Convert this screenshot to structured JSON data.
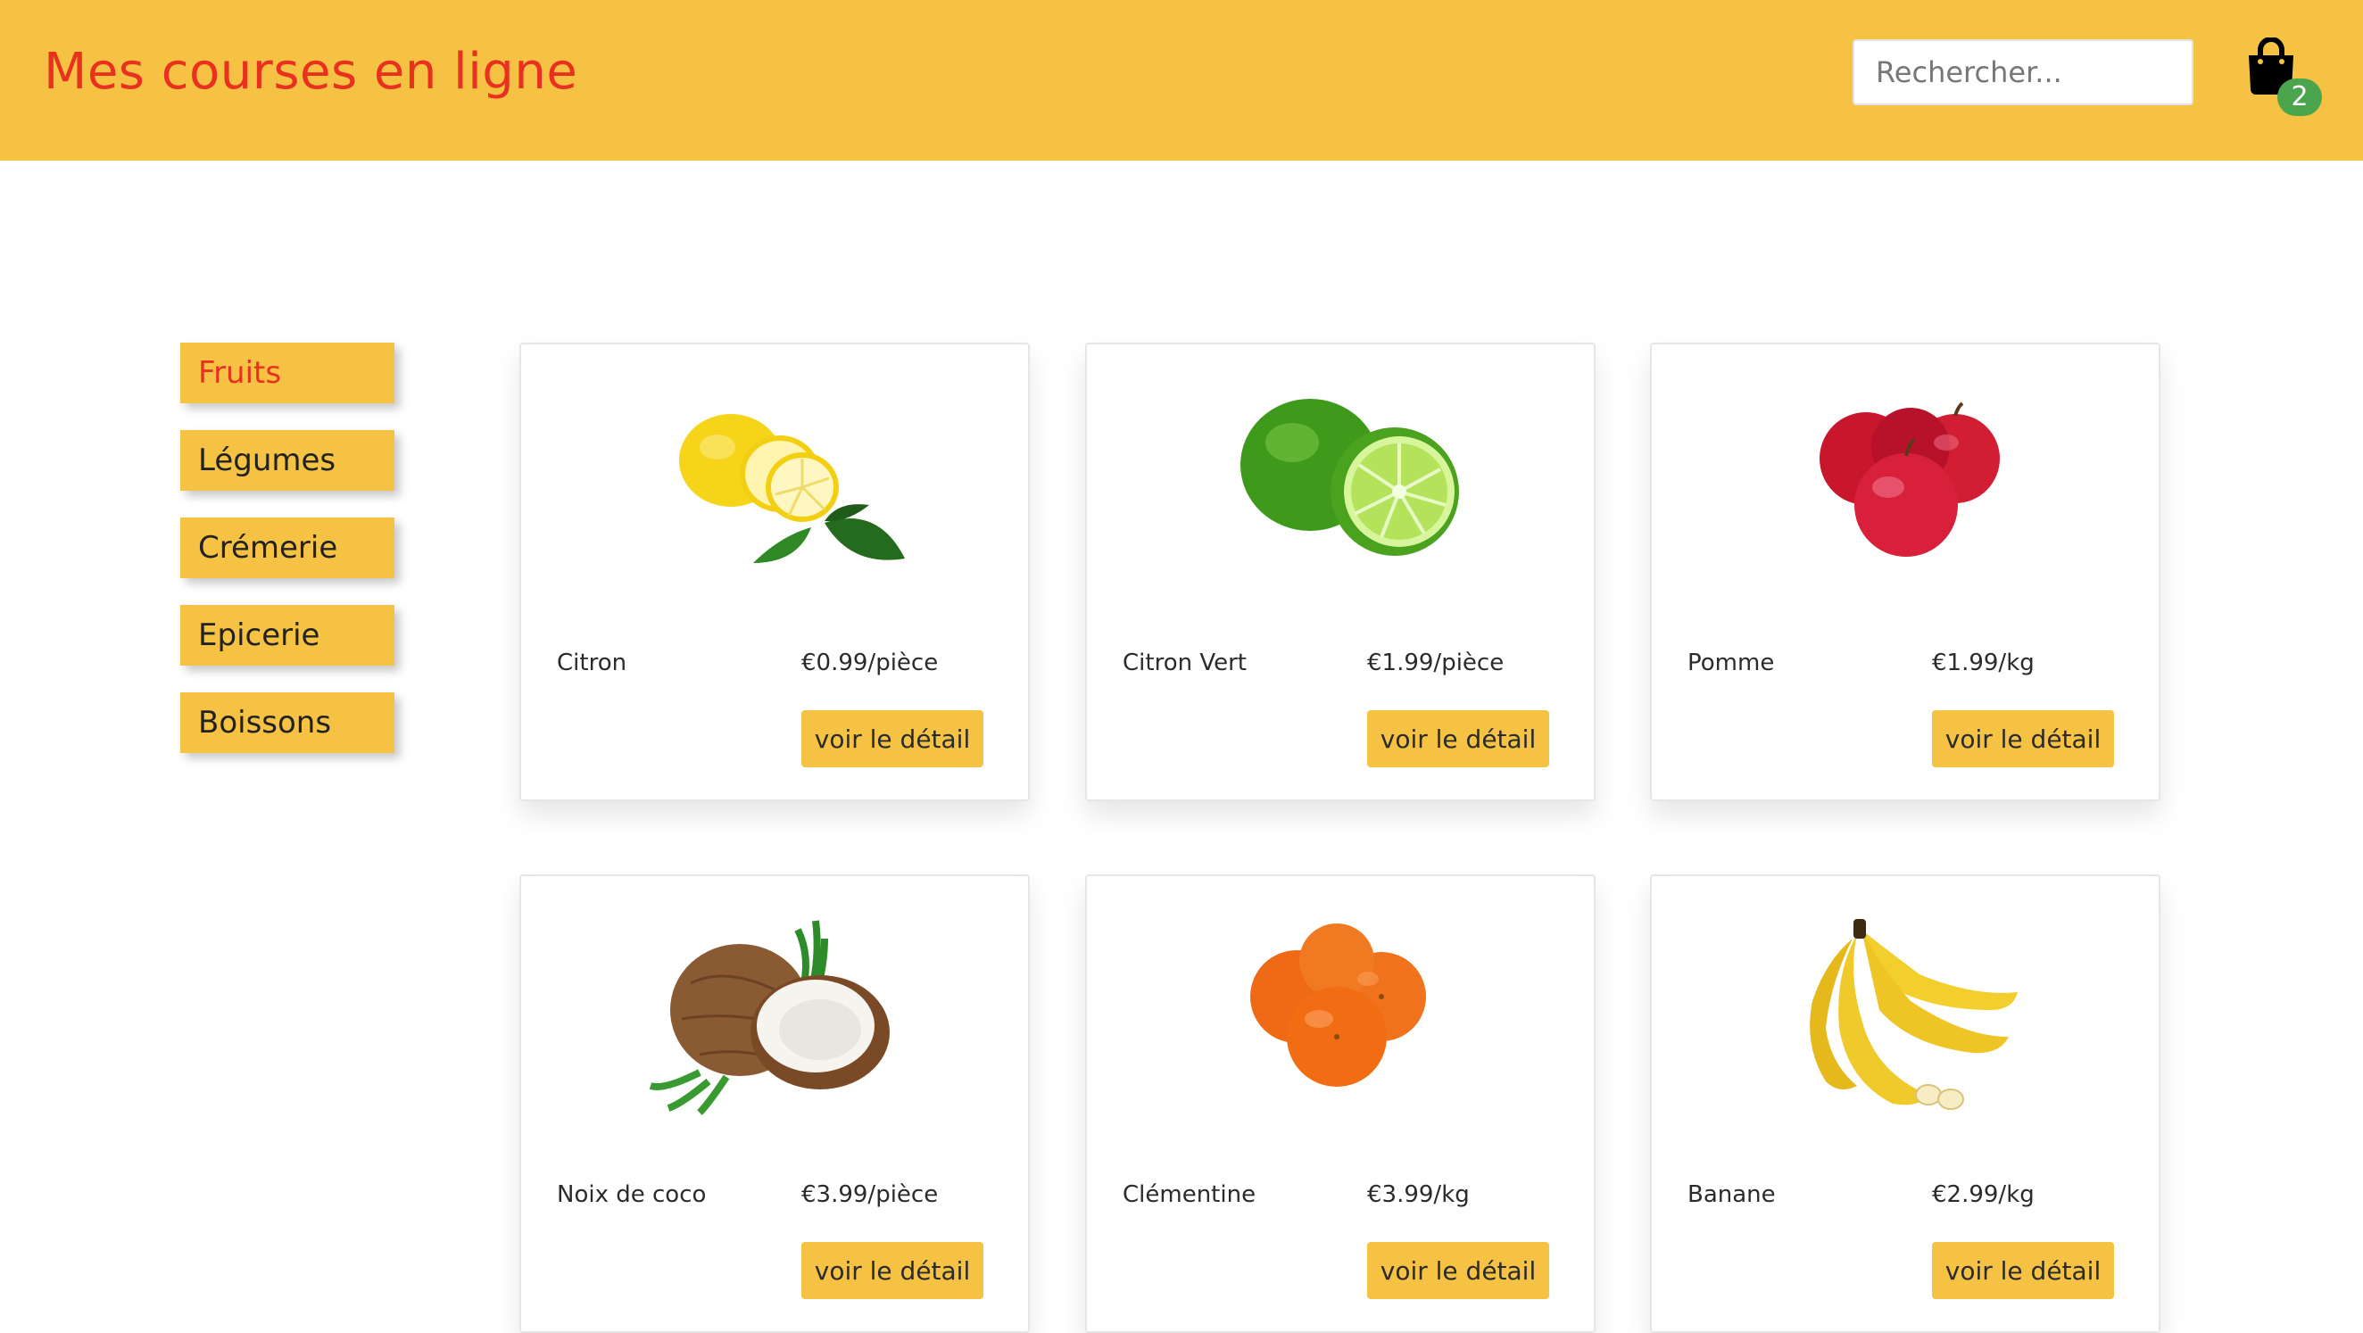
{
  "header": {
    "title": "Mes courses en ligne",
    "search_placeholder": "Rechercher...",
    "cart_count": "2"
  },
  "sidebar": {
    "items": [
      {
        "label": "Fruits"
      },
      {
        "label": "Légumes"
      },
      {
        "label": "Crémerie"
      },
      {
        "label": "Epicerie"
      },
      {
        "label": "Boissons"
      }
    ]
  },
  "products": [
    {
      "name": "Citron",
      "price": "€0.99/pièce",
      "button": "voir le détail",
      "image": "lemon"
    },
    {
      "name": "Citron Vert",
      "price": "€1.99/pièce",
      "button": "voir le détail",
      "image": "lime"
    },
    {
      "name": "Pomme",
      "price": "€1.99/kg",
      "button": "voir le détail",
      "image": "apples"
    },
    {
      "name": "Noix de coco",
      "price": "€3.99/pièce",
      "button": "voir le détail",
      "image": "coconut"
    },
    {
      "name": "Clémentine",
      "price": "€3.99/kg",
      "button": "voir le détail",
      "image": "clementines"
    },
    {
      "name": "Banane",
      "price": "€2.99/kg",
      "button": "voir le détail",
      "image": "bananas"
    }
  ],
  "colors": {
    "brand_yellow": "#f5c244",
    "title_red": "#e8321f",
    "badge_green": "#4aa54d"
  }
}
